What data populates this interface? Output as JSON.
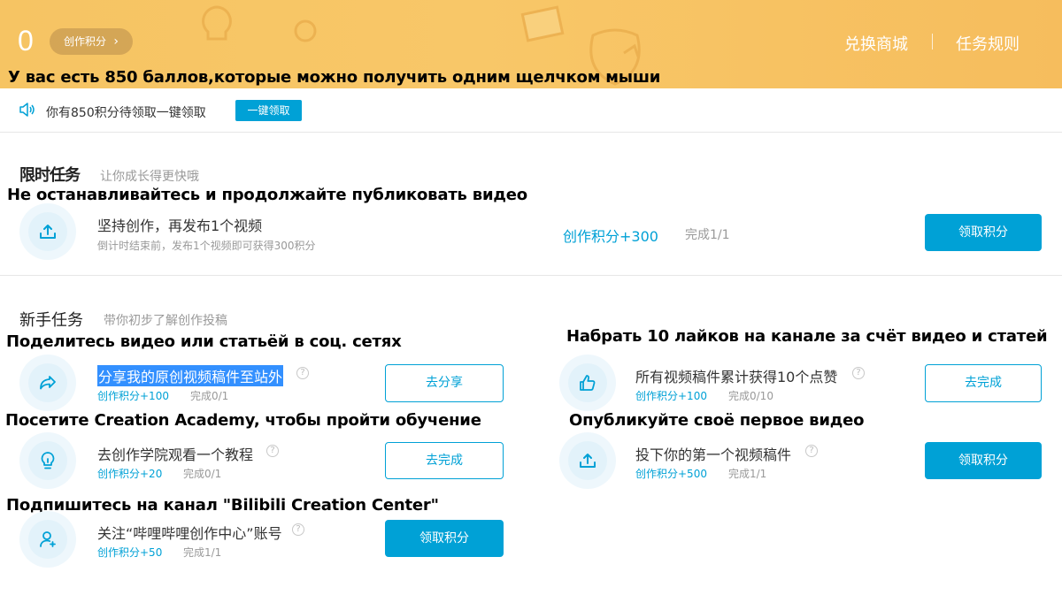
{
  "header": {
    "score": "0",
    "points_label": "创作积分",
    "links": [
      "兑换商城",
      "任务规则"
    ]
  },
  "captions": {
    "header": "У вас есть 850 баллов,которые можно получить одним щелчком мыши",
    "limited": "Не останавливайтесь и продолжайте публиковать видео",
    "share": "Поделитесь видео или статьёй в соц. сетях",
    "likes": "Набрать 10 лайков на канале за счёт видео и статей",
    "academy": "Посетите Creation Academy, чтобы пройти обучение",
    "first_video": "Опубликуйте своё первое видео",
    "subscribe": "Подпишитесь на канал \"Bilibili Creation Center\""
  },
  "notice": {
    "text": "你有850积分待领取一键领取",
    "button": "一键领取"
  },
  "limited_section": {
    "title": "限时任务",
    "subtitle": "让你成长得更快哦",
    "task": {
      "title": "坚持创作，再发布1个视频",
      "desc": "倒计时结束前，发布1个视频即可获得300积分",
      "points": "创作积分+300",
      "progress": "完成1/1",
      "button": "领取积分"
    }
  },
  "newbie_section": {
    "title": "新手任务",
    "subtitle": "带你初步了解创作投稿",
    "tasks": [
      {
        "title": "分享我的原创视频稿件至站外",
        "points": "创作积分+100",
        "progress": "完成0/1",
        "button": "去分享"
      },
      {
        "title": "所有视频稿件累计获得10个点赞",
        "points": "创作积分+100",
        "progress": "完成0/10",
        "button": "去完成"
      },
      {
        "title": "去创作学院观看一个教程",
        "points": "创作积分+20",
        "progress": "完成0/1",
        "button": "去完成"
      },
      {
        "title": "投下你的第一个视频稿件",
        "points": "创作积分+500",
        "progress": "完成1/1",
        "button": "领取积分"
      },
      {
        "title": "关注“哔哩哔哩创作中心”账号",
        "points": "创作积分+50",
        "progress": "完成1/1",
        "button": "领取积分"
      }
    ]
  },
  "colors": {
    "accent": "#00a1d6",
    "banner": "#f7c566",
    "selection": "#3390ff"
  },
  "icons": {
    "notice": "speaker-icon",
    "upload": "upload-icon",
    "share": "share-icon",
    "like": "thumbs-up-icon",
    "tutorial": "lightbulb-icon",
    "follow": "add-user-icon"
  }
}
